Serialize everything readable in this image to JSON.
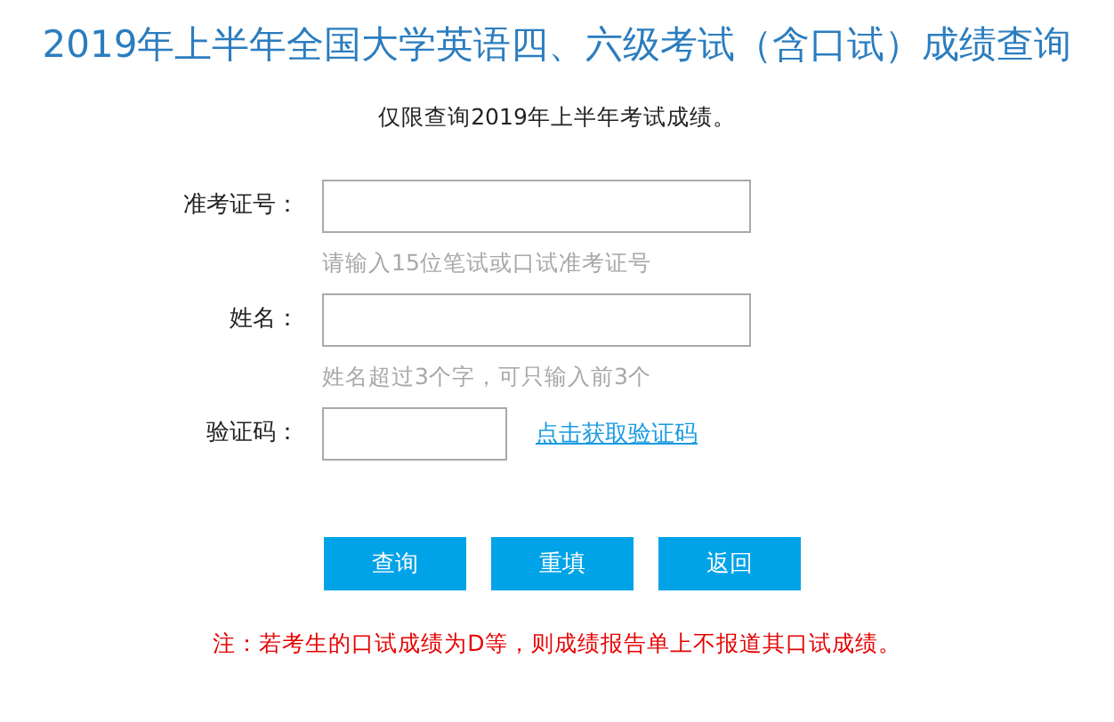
{
  "title": "2019年上半年全国大学英语四、六级考试（含口试）成绩查询",
  "subtitle": "仅限查询2019年上半年考试成绩。",
  "fields": [
    {
      "kind": "text",
      "label": "准考证号：",
      "hint": "请输入15位笔试或口试准考证号"
    },
    {
      "kind": "text",
      "label": "姓名：",
      "hint": "姓名超过3个字，可只输入前3个"
    },
    {
      "kind": "captcha",
      "label": "验证码：",
      "link": "点击获取验证码"
    }
  ],
  "buttons": [
    "查询",
    "重填",
    "返回"
  ],
  "note": "注：若考生的口试成绩为D等，则成绩报告单上不报道其口试成绩。"
}
